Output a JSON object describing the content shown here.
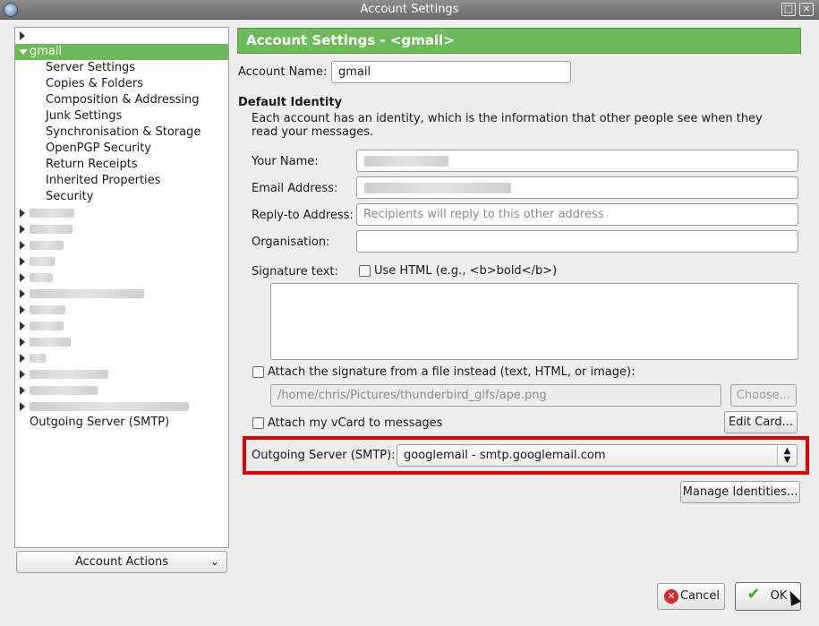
{
  "window": {
    "title": "Account Settings",
    "max_glyph": "□",
    "close_glyph": "×"
  },
  "tree": {
    "account": "gmail",
    "items": [
      "Server Settings",
      "Copies & Folders",
      "Composition & Addressing",
      "Junk Settings",
      "Synchronisation & Storage",
      "OpenPGP Security",
      "Return Receipts",
      "Inherited Properties",
      "Security"
    ],
    "outgoing": "Outgoing Server (SMTP)",
    "account_actions": "Account Actions"
  },
  "panel": {
    "header": "Account Settings - <gmail>",
    "account_name_label": "Account Name:",
    "account_name_value": "gmail",
    "default_identity_title": "Default Identity",
    "identity_desc": "Each account has an identity, which is the information that other people see when they read your messages.",
    "your_name_label": "Your Name:",
    "email_label": "Email Address:",
    "replyto_label": "Reply-to Address:",
    "replyto_placeholder": "Recipients will reply to this other address",
    "org_label": "Organisation:",
    "signature_label": "Signature text:",
    "use_html_label": "Use HTML (e.g., <b>bold</b>)",
    "attach_sig_label": "Attach the signature from a file instead (text, HTML, or image):",
    "sig_path": "/home/chris/Pictures/thunderbird_gifs/ape.png",
    "choose_button": "Choose...",
    "attach_vcard_label": "Attach my vCard to messages",
    "edit_card_button": "Edit Card...",
    "smtp_label": "Outgoing Server (SMTP):",
    "smtp_value": "googlemail - smtp.googlemail.com",
    "manage_identities_button": "Manage Identities..."
  },
  "footer": {
    "cancel": "Cancel",
    "ok": "OK"
  },
  "colors": {
    "accent": "#6cba5a",
    "highlight": "#e00000"
  }
}
